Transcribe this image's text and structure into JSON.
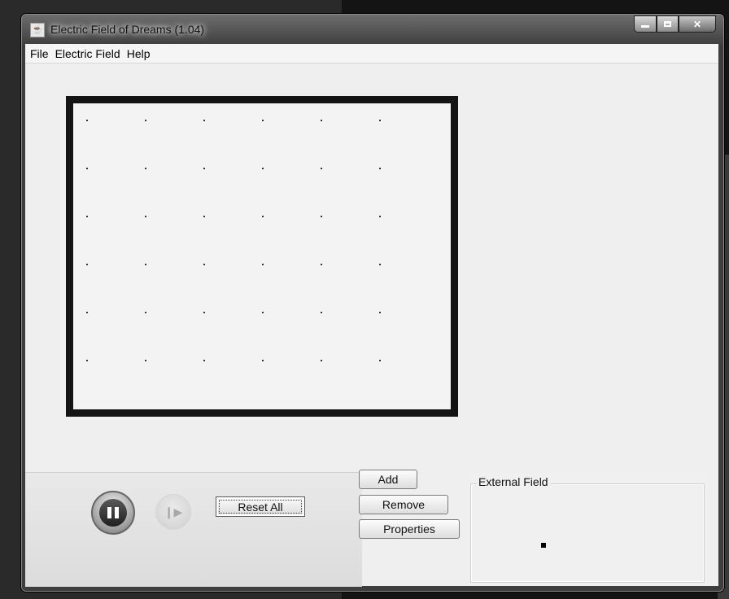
{
  "window": {
    "title": "Electric Field of Dreams (1.04)",
    "caption_buttons": {
      "minimize_icon": "minimize-icon",
      "maximize_icon": "maximize-icon",
      "close_icon": "close-icon"
    }
  },
  "menu": {
    "items": [
      {
        "label": "File"
      },
      {
        "label": "Electric Field"
      },
      {
        "label": "Help"
      }
    ]
  },
  "field": {
    "grid_rows": 6,
    "grid_cols": 6,
    "border_color": "#141414"
  },
  "controls": {
    "pause_icon": "pause-icon",
    "step_icon": "step-icon",
    "reset_label": "Reset All",
    "add_label": "Add",
    "remove_label": "Remove",
    "properties_label": "Properties"
  },
  "external_field": {
    "label": "External Field"
  }
}
